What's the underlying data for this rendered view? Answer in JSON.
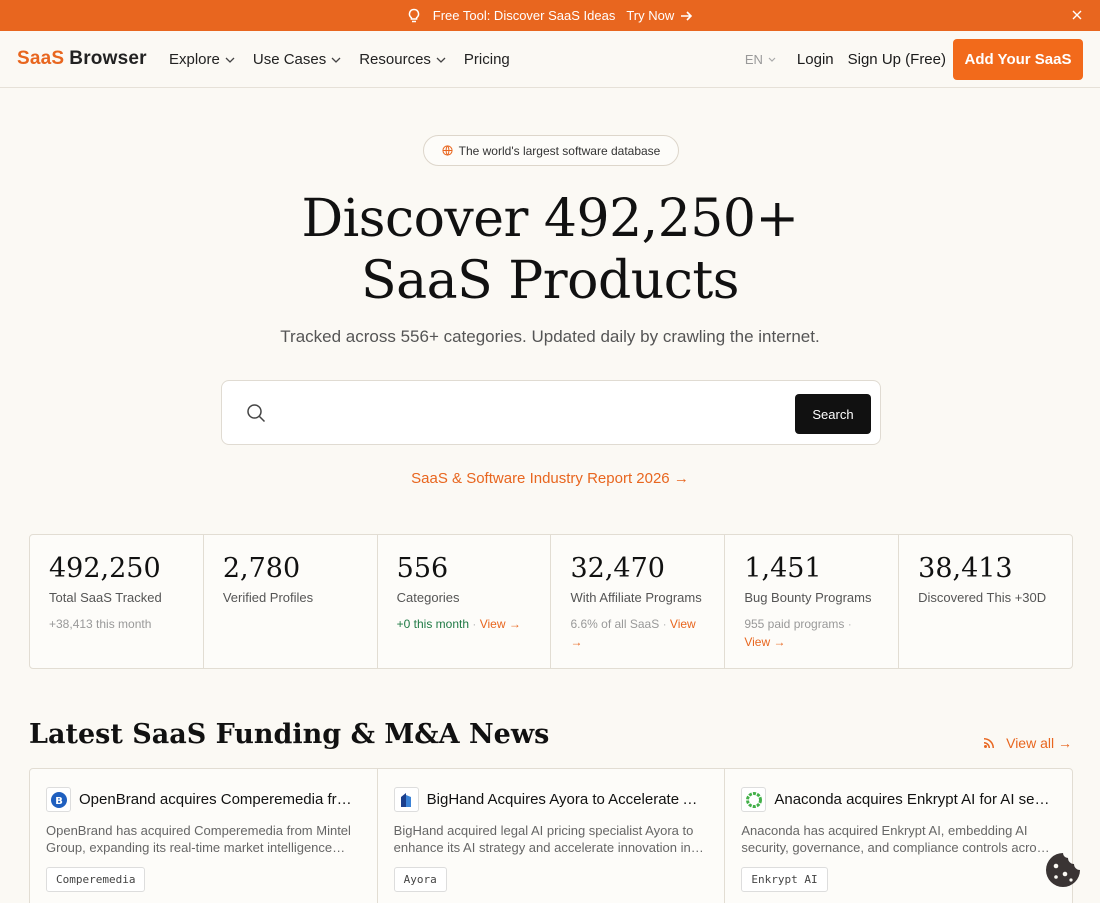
{
  "banner": {
    "text": "Free Tool: Discover SaaS Ideas",
    "try_label": "Try Now"
  },
  "header": {
    "logo_part1": "SaaS",
    "logo_part2": "Browser",
    "menu": [
      {
        "label": "Explore"
      },
      {
        "label": "Use Cases"
      },
      {
        "label": "Resources"
      },
      {
        "label": "Pricing"
      }
    ],
    "lang": "EN",
    "login": "Login",
    "signup": "Sign Up (Free)",
    "add_saas": "Add Your SaaS"
  },
  "hero": {
    "pill": "The world's largest software database",
    "title_line1": "Discover 492,250+",
    "title_line2": "SaaS Products",
    "subtitle": "Tracked across 556+ categories. Updated daily by crawling the internet.",
    "search_placeholder": "",
    "search_button": "Search",
    "report_link": "SaaS & Software Industry Report 2026 →"
  },
  "stats": [
    {
      "num": "492,250",
      "label": "Total SaaS Tracked",
      "sub": "+38,413 this month"
    },
    {
      "num": "2,780",
      "label": "Verified Profiles",
      "sub": ""
    },
    {
      "num": "556",
      "label": "Categories",
      "sub_green": "+0 this month",
      "sub_link": "View →"
    },
    {
      "num": "32,470",
      "label": "With Affiliate Programs",
      "sub": "6.6% of all SaaS",
      "sub_link": "View →"
    },
    {
      "num": "1,451",
      "label": "Bug Bounty Programs",
      "sub": "955 paid programs",
      "sub_link": "View →"
    },
    {
      "num": "38,413",
      "label": "Discovered This +30D",
      "sub": ""
    }
  ],
  "news": {
    "title": "Latest SaaS Funding & M&A News",
    "view_all": "View all →",
    "items": [
      {
        "title": "OpenBrand acquires Comperemedia from Mintel",
        "desc": "OpenBrand has acquired Comperemedia from Mintel Group, expanding its real-time market intelligence capabilities.",
        "tag": "Comperemedia",
        "fav_icon": "openbrand-logo"
      },
      {
        "title": "BigHand Acquires Ayora to Accelerate AI Innovation",
        "desc": "BigHand acquired legal AI pricing specialist Ayora to enhance its AI strategy and accelerate innovation in legal tech.",
        "tag": "Ayora",
        "fav_icon": "bighand-logo"
      },
      {
        "title": "Anaconda acquires Enkrypt AI for AI security",
        "desc": "Anaconda has acquired Enkrypt AI, embedding AI security, governance, and compliance controls across its platform.",
        "tag": "Enkrypt AI",
        "fav_icon": "anaconda-logo"
      }
    ]
  },
  "colors": {
    "accent": "#e8661f",
    "dark": "#111111",
    "green": "#1f7a45"
  }
}
